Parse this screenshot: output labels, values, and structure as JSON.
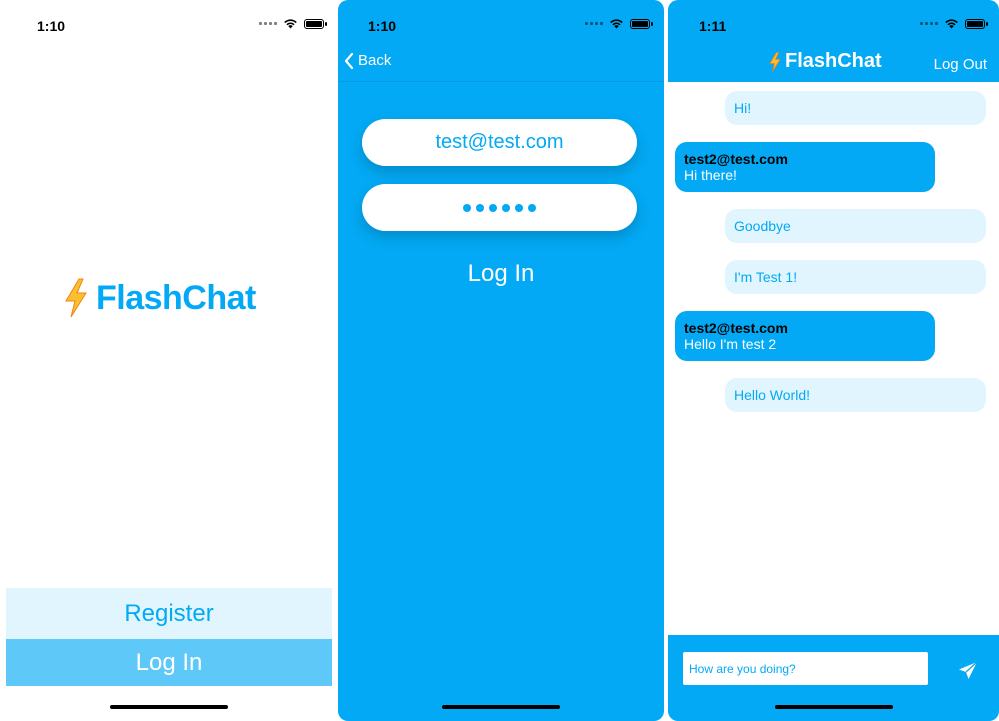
{
  "colors": {
    "brand": "#03a9f4",
    "lightBrand": "#e1f5fe",
    "midBrand": "#5ec8f8",
    "bolt": "#fbc02d"
  },
  "welcome": {
    "time": "1:10",
    "logo_emoji": "⚡️",
    "logo_text": "FlashChat",
    "register_label": "Register",
    "login_label": "Log In"
  },
  "login": {
    "time": "1:10",
    "back_label": "Back",
    "email_value": "test@test.com",
    "password_mask": "••••••",
    "login_label": "Log In"
  },
  "chat": {
    "time": "1:11",
    "title_emoji": "⚡️",
    "title": "FlashChat",
    "logout_label": "Log Out",
    "messages": [
      {
        "mine": true,
        "text": "Hi!"
      },
      {
        "mine": false,
        "sender": "test2@test.com",
        "text": "Hi there!"
      },
      {
        "mine": true,
        "text": "Goodbye"
      },
      {
        "mine": true,
        "text": "I'm Test 1!"
      },
      {
        "mine": false,
        "sender": "test2@test.com",
        "text": "Hello I'm test 2"
      },
      {
        "mine": true,
        "text": "Hello World!"
      }
    ],
    "composer_value": "How are you doing?",
    "send_icon": "paperplane-icon"
  }
}
